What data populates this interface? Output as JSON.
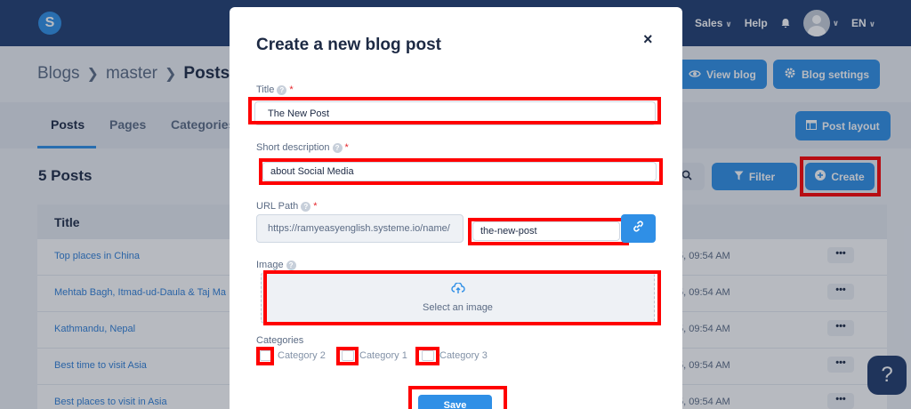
{
  "app": {
    "nav": {
      "sales": "Sales",
      "help": "Help",
      "lang": "EN",
      "logo": "S"
    },
    "breadcrumb": [
      "Blogs",
      "master",
      "Posts"
    ],
    "header_buttons": {
      "view_blog": "View blog",
      "blog_settings": "Blog settings"
    },
    "tabs": [
      "Posts",
      "Pages",
      "Categories"
    ],
    "post_layout": "Post layout",
    "posts_count": "5 Posts",
    "filter": "Filter",
    "create": "Create",
    "table": {
      "header": "Title",
      "rows": [
        {
          "title": "Top places in China",
          "date": "5, 09:54 AM",
          "actions": "•••"
        },
        {
          "title": "Mehtab Bagh, Itmad-ud-Daula & Taj Ma",
          "date": "5, 09:54 AM",
          "actions": "•••"
        },
        {
          "title": "Kathmandu, Nepal",
          "date": "5, 09:54 AM",
          "actions": "•••"
        },
        {
          "title": "Best time to visit Asia",
          "date": "5, 09:54 AM",
          "actions": "•••"
        },
        {
          "title": "Best places to visit in Asia",
          "date": "5, 09:54 AM",
          "actions": "•••"
        }
      ]
    },
    "help_button": "?"
  },
  "modal": {
    "title": "Create a new blog post",
    "close": "×",
    "fields": {
      "title": {
        "label": "Title",
        "value": "The New Post"
      },
      "short_description": {
        "label": "Short description",
        "value": "about Social Media"
      },
      "url_path": {
        "label": "URL Path",
        "prefix": "https://ramyeasyenglish.systeme.io/name/",
        "value": "the-new-post"
      },
      "image": {
        "label": "Image",
        "placeholder": "Select an image"
      },
      "categories": {
        "label": "Categories",
        "options": [
          "Category 2",
          "Category 1",
          "Category 3"
        ]
      }
    },
    "required_mark": "*",
    "info_mark": "?",
    "save": "Save"
  },
  "colors": {
    "accent": "#2f8fe6",
    "highlight": "#ff0000",
    "navbar": "#203d70"
  }
}
